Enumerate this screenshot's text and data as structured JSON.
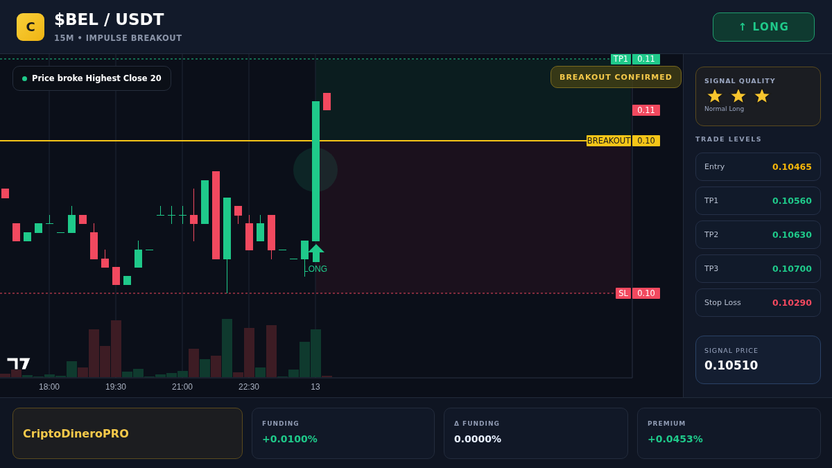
{
  "header": {
    "logo_letter": "C",
    "pair": "$BEL / USDT",
    "subtitle": "15M • IMPULSE BREAKOUT",
    "direction_button": "↑ LONG"
  },
  "chart": {
    "notice": "Price broke Highest Close 20",
    "badge": "BREAKOUT CONFIRMED",
    "signal_label": "LONG",
    "time_labels": [
      "18:00",
      "19:30",
      "21:00",
      "22:30",
      "13"
    ],
    "levels": [
      {
        "kind": "tp",
        "name": "TP1",
        "value": "0.11"
      },
      {
        "kind": "last",
        "value": "0.11"
      },
      {
        "kind": "breakout",
        "name": "BREAKOUT",
        "value": "0.10"
      },
      {
        "kind": "sl",
        "name": "SL",
        "value": "0.10"
      }
    ]
  },
  "signal_quality": {
    "title": "SIGNAL QUALITY",
    "stars": 3,
    "label": "Normal Long"
  },
  "trade_levels": {
    "title": "TRADE LEVELS",
    "rows": [
      {
        "label": "Entry",
        "value": "0.10465",
        "kind": "entry"
      },
      {
        "label": "TP1",
        "value": "0.10560",
        "kind": "target"
      },
      {
        "label": "TP2",
        "value": "0.10630",
        "kind": "target"
      },
      {
        "label": "TP3",
        "value": "0.10700",
        "kind": "target"
      },
      {
        "label": "Stop Loss",
        "value": "0.10290",
        "kind": "stop"
      }
    ]
  },
  "signal_price": {
    "label": "SIGNAL PRICE",
    "value": "0.10510"
  },
  "footer": {
    "brand": "CriptoDineroPRO",
    "stats": [
      {
        "label": "FUNDING",
        "value": "+0.0100%",
        "kind": "positive"
      },
      {
        "label": "Δ FUNDING",
        "value": "0.0000%",
        "kind": "neutral"
      },
      {
        "label": "PREMIUM",
        "value": "+0.0453%",
        "kind": "positive"
      }
    ]
  }
}
